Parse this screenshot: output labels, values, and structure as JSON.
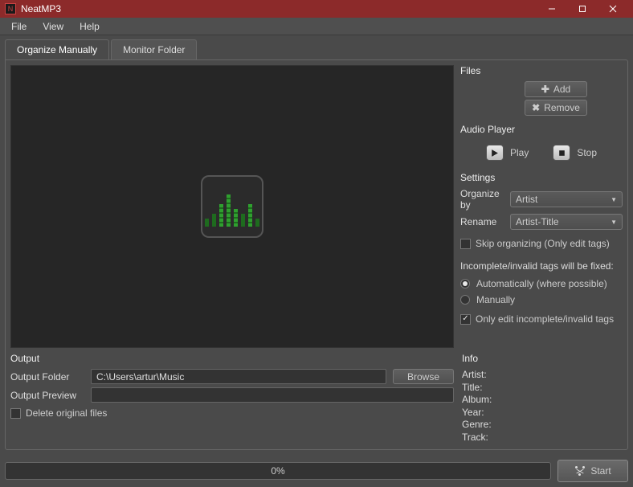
{
  "app": {
    "title": "NeatMP3"
  },
  "menu": {
    "file": "File",
    "view": "View",
    "help": "Help"
  },
  "tabs": {
    "organize": "Organize Manually",
    "monitor": "Monitor Folder"
  },
  "files": {
    "title": "Files",
    "add": "Add",
    "remove": "Remove"
  },
  "player": {
    "title": "Audio Player",
    "play": "Play",
    "stop": "Stop"
  },
  "settings": {
    "title": "Settings",
    "organize_by_label": "Organize by",
    "organize_by_value": "Artist",
    "rename_label": "Rename",
    "rename_value": "Artist-Title",
    "skip_label": "Skip organizing (Only edit tags)",
    "fix_note": "Incomplete/invalid tags will be fixed:",
    "auto_label": "Automatically (where possible)",
    "manual_label": "Manually",
    "only_edit_label": "Only edit incomplete/invalid tags"
  },
  "output": {
    "title": "Output",
    "folder_label": "Output Folder",
    "folder_value": "C:\\Users\\artur\\Music",
    "browse": "Browse",
    "preview_label": "Output Preview",
    "delete_label": "Delete original files"
  },
  "info": {
    "title": "Info",
    "artist": "Artist:",
    "title_field": "Title:",
    "album": "Album:",
    "year": "Year:",
    "genre": "Genre:",
    "track": "Track:"
  },
  "footer": {
    "progress": "0%",
    "start": "Start"
  }
}
